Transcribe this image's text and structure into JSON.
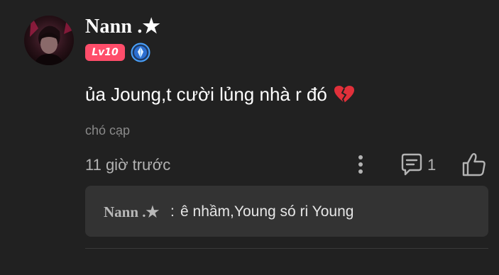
{
  "user": {
    "name": "Nann .★",
    "level_badge": "Lv10"
  },
  "comment": {
    "text": "ủa Joung,t cười lủng nhà r đó",
    "emoji_icon": "broken-heart-icon",
    "tag": "chó cạp",
    "time": "11 giờ trước",
    "reply_count": "1"
  },
  "reply": {
    "author": "Nann .★",
    "separator": ":",
    "text": "ê nhầm,Young só ri Young"
  },
  "colors": {
    "background": "#212121",
    "badge": "#ff4d6a",
    "reply_box": "#333333",
    "rank_icon": "#4aa3ff"
  }
}
